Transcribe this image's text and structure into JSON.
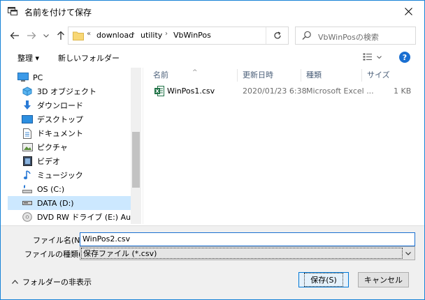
{
  "window": {
    "title": "名前を付けて保存",
    "accent_color": "#1883d7"
  },
  "nav": {
    "back_icon": "back-arrow-icon",
    "forward_icon": "forward-arrow-icon",
    "recent_icon": "chevron-down-icon",
    "up_icon": "up-arrow-icon",
    "overflow": "«",
    "breadcrumbs": [
      "download",
      "utility",
      "VbWinPos"
    ],
    "search_placeholder": "VbWinPosの検索"
  },
  "cmdbar": {
    "organize": "整理 ▾",
    "new_folder": "新しいフォルダー",
    "help": "?"
  },
  "tree": [
    {
      "label": "PC",
      "icon": "pc-icon"
    },
    {
      "label": "3D オブジェクト",
      "icon": "3d-objects-icon"
    },
    {
      "label": "ダウンロード",
      "icon": "download-icon"
    },
    {
      "label": "デスクトップ",
      "icon": "desktop-icon"
    },
    {
      "label": "ドキュメント",
      "icon": "documents-icon"
    },
    {
      "label": "ピクチャ",
      "icon": "pictures-icon"
    },
    {
      "label": "ビデオ",
      "icon": "videos-icon"
    },
    {
      "label": "ミュージック",
      "icon": "music-icon"
    },
    {
      "label": "OS (C:)",
      "icon": "drive-icon"
    },
    {
      "label": "DATA (D:)",
      "icon": "drive-icon",
      "selected": true
    },
    {
      "label": "DVD RW ドライブ (E:) Audio CD",
      "icon": "cd-icon"
    }
  ],
  "columns": {
    "name": "名前",
    "date": "更新日時",
    "type": "種類",
    "size": "サイズ"
  },
  "files": [
    {
      "name": "WinPos1.csv",
      "date": "2020/01/23 6:38",
      "type": "Microsoft Excel ...",
      "size": "1 KB",
      "icon": "excel-icon"
    }
  ],
  "form": {
    "filename_label": "ファイル名(N):",
    "filename_value": "WinPos2.csv",
    "filetype_label": "ファイルの種類(T):",
    "filetype_value": "保存ファイル (*.csv)"
  },
  "footer": {
    "hide_folders": "フォルダーの非表示",
    "save": "保存(S)",
    "cancel": "キャンセル"
  }
}
